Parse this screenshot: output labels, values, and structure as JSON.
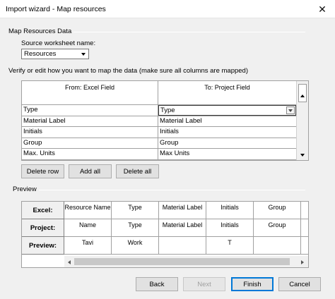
{
  "window": {
    "title": "Import wizard - Map resources",
    "close_glyph": "✕"
  },
  "group_title": "Map Resources Data",
  "source": {
    "label": "Source worksheet name:",
    "value": "Resources"
  },
  "instructions": "Verify or edit how you want to map the data (make sure all columns are mapped)",
  "map_table": {
    "headers": {
      "from": "From: Excel Field",
      "to": "To: Project Field"
    },
    "rows": [
      {
        "from": "Type",
        "to": "Type"
      },
      {
        "from": "Material Label",
        "to": "Material Label"
      },
      {
        "from": "Initials",
        "to": "Initials"
      },
      {
        "from": "Group",
        "to": "Group"
      },
      {
        "from": "Max. Units",
        "to": "Max Units"
      }
    ]
  },
  "row_buttons": {
    "delete_row": "Delete row",
    "add_all": "Add all",
    "delete_all": "Delete all"
  },
  "preview": {
    "title": "Preview",
    "row_headers": [
      "Excel:",
      "Project:",
      "Preview:"
    ],
    "excel": [
      "Resource Name",
      "Type",
      "Material Label",
      "Initials",
      "Group",
      ""
    ],
    "project": [
      "Name",
      "Type",
      "Material Label",
      "Initials",
      "Group",
      ""
    ],
    "values": [
      "Tavi",
      "Work",
      "",
      "T",
      "",
      ""
    ]
  },
  "footer": {
    "back": "Back",
    "next": "Next",
    "finish": "Finish",
    "cancel": "Cancel"
  }
}
